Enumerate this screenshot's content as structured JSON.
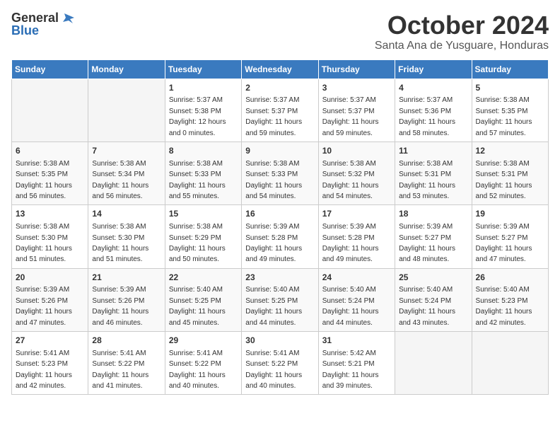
{
  "logo": {
    "text_general": "General",
    "text_blue": "Blue"
  },
  "title": "October 2024",
  "location": "Santa Ana de Yusguare, Honduras",
  "days_header": [
    "Sunday",
    "Monday",
    "Tuesday",
    "Wednesday",
    "Thursday",
    "Friday",
    "Saturday"
  ],
  "weeks": [
    [
      {
        "day": "",
        "info": ""
      },
      {
        "day": "",
        "info": ""
      },
      {
        "day": "1",
        "info": "Sunrise: 5:37 AM\nSunset: 5:38 PM\nDaylight: 12 hours\nand 0 minutes."
      },
      {
        "day": "2",
        "info": "Sunrise: 5:37 AM\nSunset: 5:37 PM\nDaylight: 11 hours\nand 59 minutes."
      },
      {
        "day": "3",
        "info": "Sunrise: 5:37 AM\nSunset: 5:37 PM\nDaylight: 11 hours\nand 59 minutes."
      },
      {
        "day": "4",
        "info": "Sunrise: 5:37 AM\nSunset: 5:36 PM\nDaylight: 11 hours\nand 58 minutes."
      },
      {
        "day": "5",
        "info": "Sunrise: 5:38 AM\nSunset: 5:35 PM\nDaylight: 11 hours\nand 57 minutes."
      }
    ],
    [
      {
        "day": "6",
        "info": "Sunrise: 5:38 AM\nSunset: 5:35 PM\nDaylight: 11 hours\nand 56 minutes."
      },
      {
        "day": "7",
        "info": "Sunrise: 5:38 AM\nSunset: 5:34 PM\nDaylight: 11 hours\nand 56 minutes."
      },
      {
        "day": "8",
        "info": "Sunrise: 5:38 AM\nSunset: 5:33 PM\nDaylight: 11 hours\nand 55 minutes."
      },
      {
        "day": "9",
        "info": "Sunrise: 5:38 AM\nSunset: 5:33 PM\nDaylight: 11 hours\nand 54 minutes."
      },
      {
        "day": "10",
        "info": "Sunrise: 5:38 AM\nSunset: 5:32 PM\nDaylight: 11 hours\nand 54 minutes."
      },
      {
        "day": "11",
        "info": "Sunrise: 5:38 AM\nSunset: 5:31 PM\nDaylight: 11 hours\nand 53 minutes."
      },
      {
        "day": "12",
        "info": "Sunrise: 5:38 AM\nSunset: 5:31 PM\nDaylight: 11 hours\nand 52 minutes."
      }
    ],
    [
      {
        "day": "13",
        "info": "Sunrise: 5:38 AM\nSunset: 5:30 PM\nDaylight: 11 hours\nand 51 minutes."
      },
      {
        "day": "14",
        "info": "Sunrise: 5:38 AM\nSunset: 5:30 PM\nDaylight: 11 hours\nand 51 minutes."
      },
      {
        "day": "15",
        "info": "Sunrise: 5:38 AM\nSunset: 5:29 PM\nDaylight: 11 hours\nand 50 minutes."
      },
      {
        "day": "16",
        "info": "Sunrise: 5:39 AM\nSunset: 5:28 PM\nDaylight: 11 hours\nand 49 minutes."
      },
      {
        "day": "17",
        "info": "Sunrise: 5:39 AM\nSunset: 5:28 PM\nDaylight: 11 hours\nand 49 minutes."
      },
      {
        "day": "18",
        "info": "Sunrise: 5:39 AM\nSunset: 5:27 PM\nDaylight: 11 hours\nand 48 minutes."
      },
      {
        "day": "19",
        "info": "Sunrise: 5:39 AM\nSunset: 5:27 PM\nDaylight: 11 hours\nand 47 minutes."
      }
    ],
    [
      {
        "day": "20",
        "info": "Sunrise: 5:39 AM\nSunset: 5:26 PM\nDaylight: 11 hours\nand 47 minutes."
      },
      {
        "day": "21",
        "info": "Sunrise: 5:39 AM\nSunset: 5:26 PM\nDaylight: 11 hours\nand 46 minutes."
      },
      {
        "day": "22",
        "info": "Sunrise: 5:40 AM\nSunset: 5:25 PM\nDaylight: 11 hours\nand 45 minutes."
      },
      {
        "day": "23",
        "info": "Sunrise: 5:40 AM\nSunset: 5:25 PM\nDaylight: 11 hours\nand 44 minutes."
      },
      {
        "day": "24",
        "info": "Sunrise: 5:40 AM\nSunset: 5:24 PM\nDaylight: 11 hours\nand 44 minutes."
      },
      {
        "day": "25",
        "info": "Sunrise: 5:40 AM\nSunset: 5:24 PM\nDaylight: 11 hours\nand 43 minutes."
      },
      {
        "day": "26",
        "info": "Sunrise: 5:40 AM\nSunset: 5:23 PM\nDaylight: 11 hours\nand 42 minutes."
      }
    ],
    [
      {
        "day": "27",
        "info": "Sunrise: 5:41 AM\nSunset: 5:23 PM\nDaylight: 11 hours\nand 42 minutes."
      },
      {
        "day": "28",
        "info": "Sunrise: 5:41 AM\nSunset: 5:22 PM\nDaylight: 11 hours\nand 41 minutes."
      },
      {
        "day": "29",
        "info": "Sunrise: 5:41 AM\nSunset: 5:22 PM\nDaylight: 11 hours\nand 40 minutes."
      },
      {
        "day": "30",
        "info": "Sunrise: 5:41 AM\nSunset: 5:22 PM\nDaylight: 11 hours\nand 40 minutes."
      },
      {
        "day": "31",
        "info": "Sunrise: 5:42 AM\nSunset: 5:21 PM\nDaylight: 11 hours\nand 39 minutes."
      },
      {
        "day": "",
        "info": ""
      },
      {
        "day": "",
        "info": ""
      }
    ]
  ]
}
